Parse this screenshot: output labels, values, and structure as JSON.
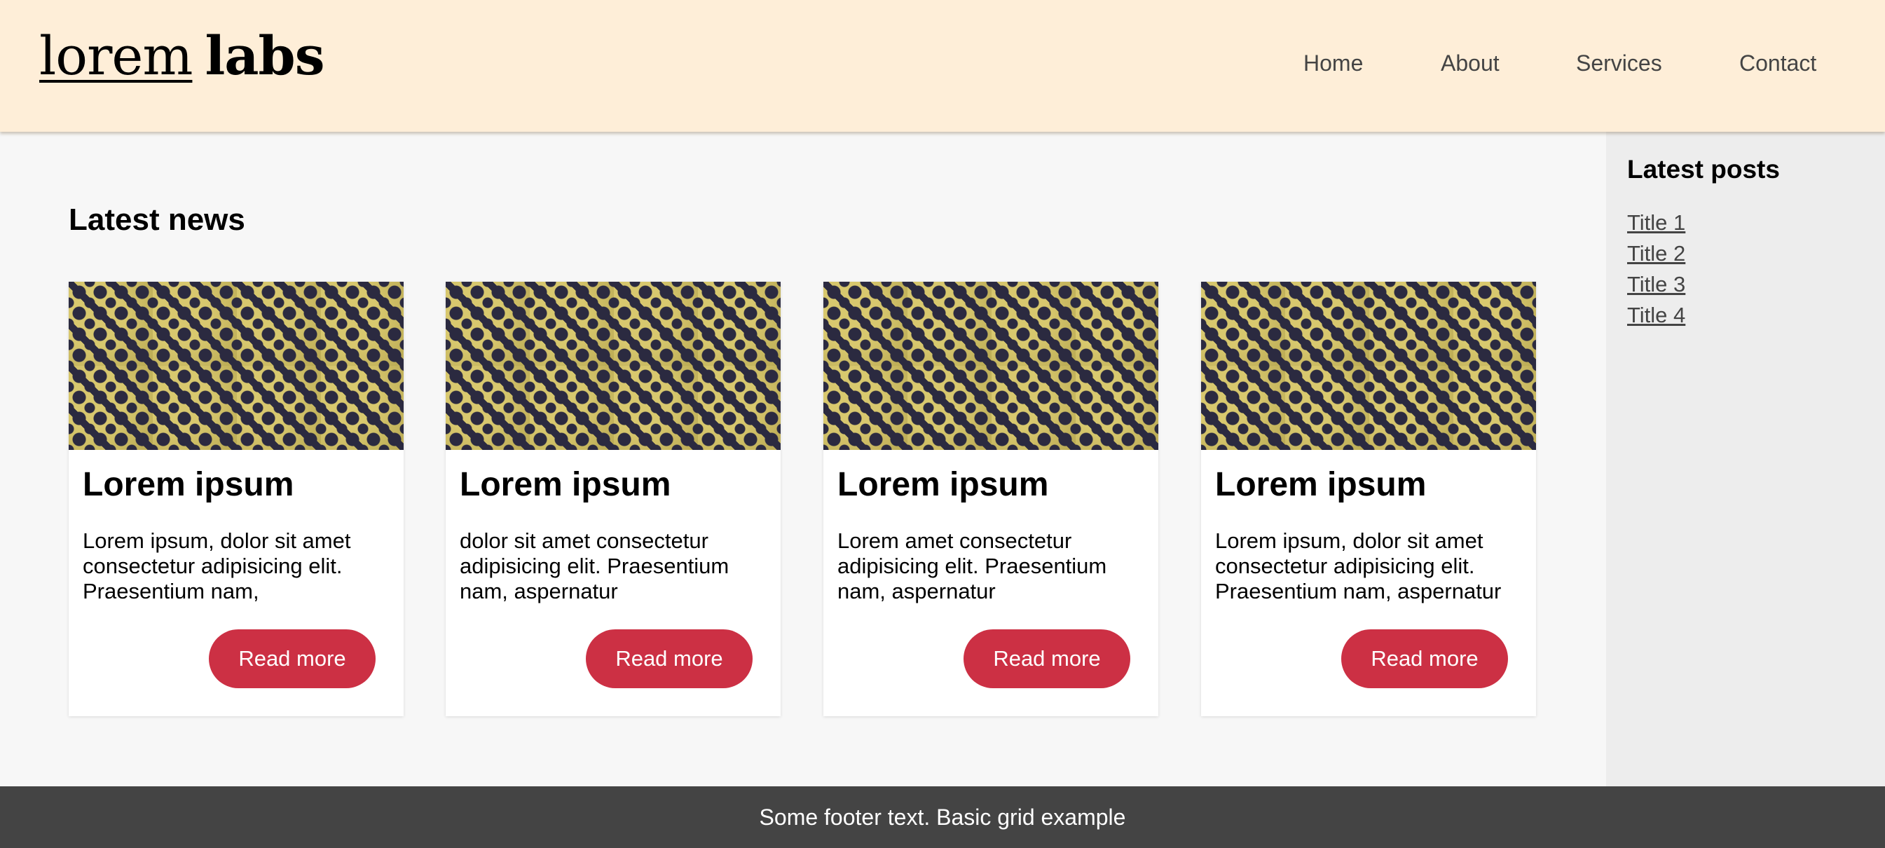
{
  "header": {
    "logo_light": "lorem",
    "logo_bold": "labs",
    "nav": [
      {
        "label": "Home"
      },
      {
        "label": "About"
      },
      {
        "label": "Services"
      },
      {
        "label": "Contact"
      }
    ]
  },
  "main": {
    "heading": "Latest news",
    "cards": [
      {
        "image": "pattern-image",
        "title": "Lorem ipsum",
        "text": "Lorem ipsum, dolor sit amet consectetur adipisicing elit. Praesentium nam,",
        "button": "Read more"
      },
      {
        "image": "pattern-image",
        "title": "Lorem ipsum",
        "text": "dolor sit amet consectetur adipisicing elit. Praesentium nam, aspernatur",
        "button": "Read more"
      },
      {
        "image": "pattern-image",
        "title": "Lorem ipsum",
        "text": "Lorem amet consectetur adipisicing elit. Praesentium nam, aspernatur",
        "button": "Read more"
      },
      {
        "image": "pattern-image",
        "title": "Lorem ipsum",
        "text": "Lorem ipsum, dolor sit amet consectetur adipisicing elit. Praesentium nam, aspernatur",
        "button": "Read more"
      }
    ]
  },
  "sidebar": {
    "heading": "Latest posts",
    "links": [
      {
        "label": "Title 1"
      },
      {
        "label": "Title 2"
      },
      {
        "label": "Title 3"
      },
      {
        "label": "Title 4"
      }
    ]
  },
  "footer": {
    "text": "Some footer text. Basic grid example"
  },
  "colors": {
    "header_bg": "#feeed8",
    "button": "#cc3044",
    "footer_bg": "#444444",
    "sidebar_bg": "#ededed",
    "main_bg": "#f7f7f7"
  }
}
